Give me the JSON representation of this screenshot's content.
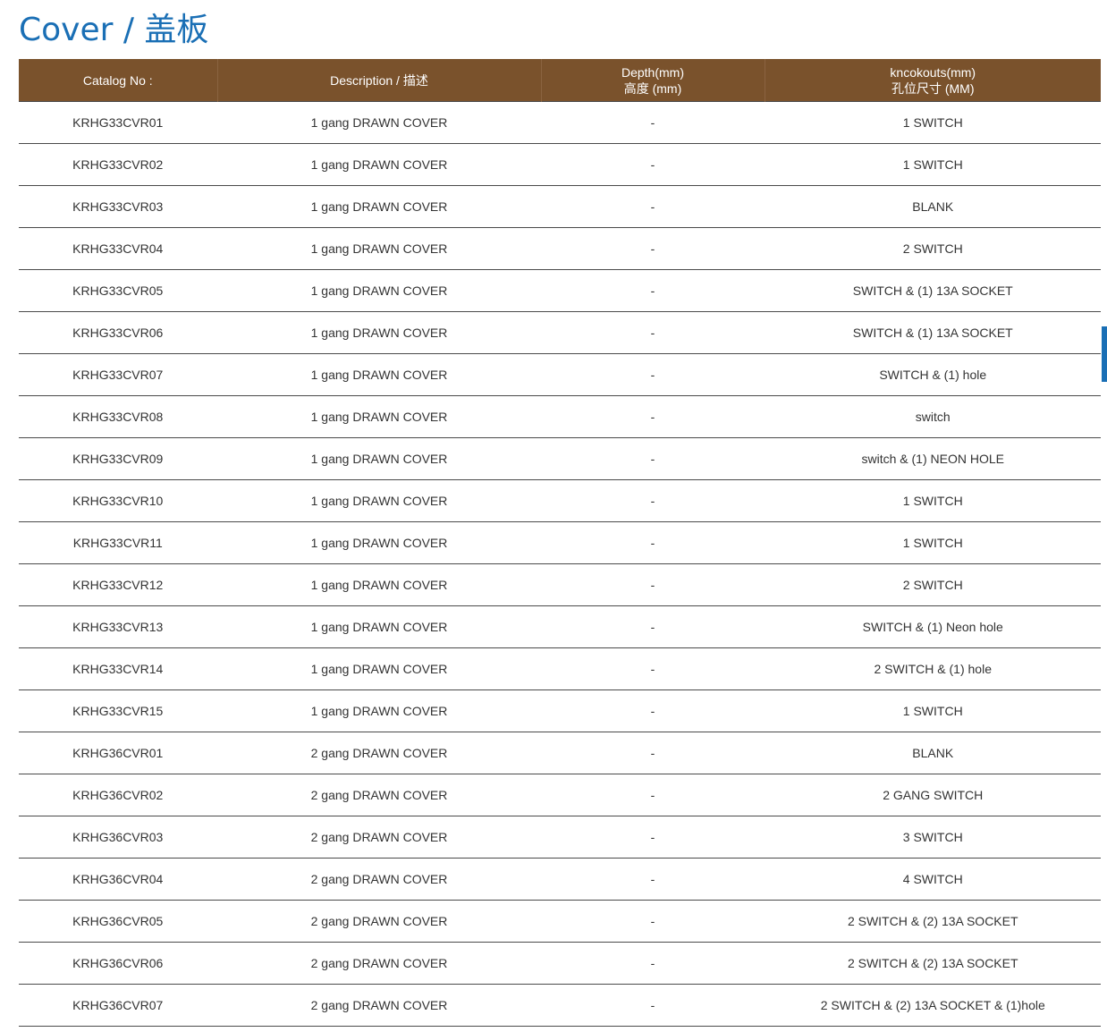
{
  "page": {
    "title": "Cover / 盖板"
  },
  "table": {
    "headers": {
      "catalog": "Catalog No :",
      "description": "Description / 描述",
      "depth_line1": "Depth(mm)",
      "depth_line2": "高度 (mm)",
      "knockouts_line1": "kncokouts(mm)",
      "knockouts_line2": "孔位尺寸 (MM)"
    },
    "rows": [
      [
        "KRHG33CVR01",
        "1 gang DRAWN COVER",
        "-",
        "1 SWITCH"
      ],
      [
        "KRHG33CVR02",
        "1 gang DRAWN COVER",
        "-",
        "1 SWITCH"
      ],
      [
        "KRHG33CVR03",
        "1 gang DRAWN COVER",
        "-",
        "BLANK"
      ],
      [
        "KRHG33CVR04",
        "1 gang DRAWN COVER",
        "-",
        "2 SWITCH"
      ],
      [
        "KRHG33CVR05",
        "1 gang DRAWN COVER",
        "-",
        "SWITCH  & (1) 13A SOCKET"
      ],
      [
        "KRHG33CVR06",
        "1 gang DRAWN COVER",
        "-",
        "SWITCH  & (1) 13A SOCKET"
      ],
      [
        "KRHG33CVR07",
        "1 gang DRAWN COVER",
        "-",
        "SWITCH & (1) hole"
      ],
      [
        "KRHG33CVR08",
        "1 gang DRAWN COVER",
        "-",
        "switch"
      ],
      [
        "KRHG33CVR09",
        "1 gang DRAWN COVER",
        "-",
        "switch & (1) NEON HOLE"
      ],
      [
        "KRHG33CVR10",
        "1 gang DRAWN COVER",
        "-",
        "1 SWITCH"
      ],
      [
        "KRHG33CVR11",
        "1 gang DRAWN COVER",
        "-",
        "1 SWITCH"
      ],
      [
        "KRHG33CVR12",
        "1 gang DRAWN COVER",
        "-",
        "2 SWITCH"
      ],
      [
        "KRHG33CVR13",
        "1 gang DRAWN COVER",
        "-",
        "SWITCH  &  (1) Neon hole"
      ],
      [
        "KRHG33CVR14",
        "1 gang DRAWN COVER",
        "-",
        "2 SWITCH  &  (1) hole"
      ],
      [
        "KRHG33CVR15",
        "1 gang DRAWN COVER",
        "-",
        "1 SWITCH"
      ],
      [
        "KRHG36CVR01",
        "2 gang DRAWN COVER",
        "-",
        "BLANK"
      ],
      [
        "KRHG36CVR02",
        "2 gang DRAWN COVER",
        "-",
        "2 GANG SWITCH"
      ],
      [
        "KRHG36CVR03",
        "2 gang DRAWN COVER",
        "-",
        "3 SWITCH"
      ],
      [
        "KRHG36CVR04",
        "2 gang DRAWN COVER",
        "-",
        "4 SWITCH"
      ],
      [
        "KRHG36CVR05",
        "2 gang DRAWN COVER",
        "-",
        "2 SWITCH  & (2) 13A SOCKET"
      ],
      [
        "KRHG36CVR06",
        "2 gang DRAWN COVER",
        "-",
        "2 SWITCH & (2) 13A SOCKET"
      ],
      [
        "KRHG36CVR07",
        "2 gang DRAWN COVER",
        "-",
        "2 SWITCH  & (2) 13A SOCKET & (1)hole"
      ]
    ]
  },
  "colors": {
    "title": "#1a6fb5",
    "header_bg": "#7a522c",
    "side_tab": "#1a6fb5"
  }
}
